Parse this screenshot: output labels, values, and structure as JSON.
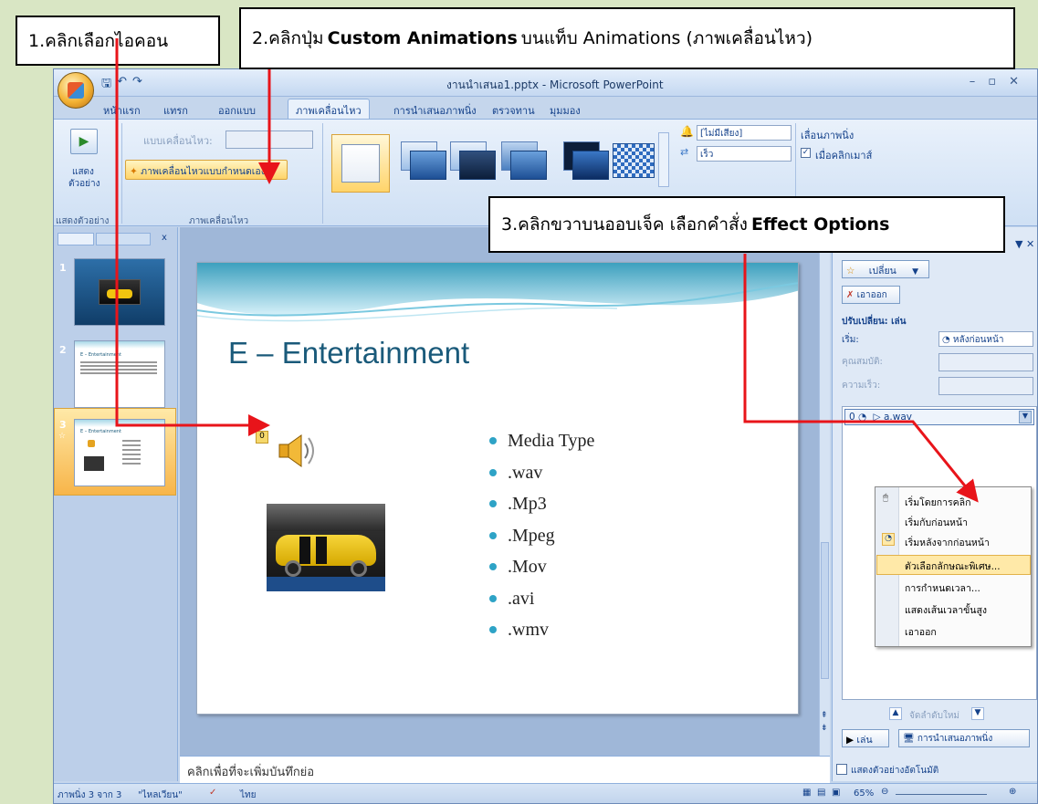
{
  "callouts": {
    "step1": "1.คลิกเลือกไอคอน",
    "step2_prefix": "2.คลิกปุ่ม",
    "step2_bold": "Custom Animations",
    "step2_suffix": "บนแท็บ Animations (ภาพเคลื่อนไหว)",
    "step3_prefix": "3.คลิกขวาบนออบเจ็ค เลือกคำสั่ง",
    "step3_bold": "Effect Options"
  },
  "window": {
    "title": "งานนำเสนอ1.pptx - Microsoft PowerPoint",
    "qat_save": "🖫",
    "qat_undo": "↶",
    "qat_redo": "↷"
  },
  "tabs": [
    {
      "label": "หน้าแรก"
    },
    {
      "label": "แทรก"
    },
    {
      "label": "ออกแบบ"
    },
    {
      "label": "ภาพเคลื่อนไหว"
    },
    {
      "label": "การนำเสนอภาพนิ่ง"
    },
    {
      "label": "ตรวจทาน"
    },
    {
      "label": "มุมมอง"
    }
  ],
  "ribbon": {
    "preview_label_1": "แสดง",
    "preview_label_2": "ตัวอย่าง",
    "preview_group": "แสดงตัวอย่าง",
    "animate_label": "แบบเคลื่อนไหว:",
    "custom_anim_button": "ภาพเคลื่อนไหวแบบกำหนดเอง",
    "anim_group": "ภาพเคลื่อนไหว",
    "sound_value": "[ไม่มีเสียง]",
    "speed_value": "เร็ว",
    "advance_title": "เลื่อนภาพนิ่ง",
    "on_click_label": "เมื่อคลิกเมาส์"
  },
  "slides_pane": {
    "slide_numbers": [
      "1",
      "2",
      "3"
    ],
    "slide2_title": "E – Entertainment",
    "slide3_title": "E – Entertainment"
  },
  "slide": {
    "title": "E – Entertainment",
    "anim_tag": "0",
    "bullets": [
      "Media Type",
      ".wav",
      ".Mp3",
      ".Mpeg",
      ".Mov",
      ".avi",
      ".wmv"
    ]
  },
  "notes": {
    "placeholder": "คลิกเพื่อที่จะเพิ่มบันทึกย่อ"
  },
  "taskpane": {
    "change_button": "เปลี่ยน",
    "remove_button": "เอาออก",
    "modify_heading": "ปรับเปลี่ยน: เล่น",
    "start_label": "เริ่ม:",
    "start_value": "หลังก่อนหน้า",
    "property_label": "คุณสมบัติ:",
    "speed_label": "ความเร็ว:",
    "list_item_num": "0",
    "list_item_name": "a.wav",
    "reorder_label": "จัดลำดับใหม่",
    "play_button": "เล่น",
    "slideshow_button": "การนำเสนอภาพนิ่ง",
    "autopreview_label": "แสดงตัวอย่างอัตโนมัติ"
  },
  "context_menu": [
    "เริ่มโดยการคลิก",
    "เริ่มกับก่อนหน้า",
    "เริ่มหลังจากก่อนหน้า",
    "ตัวเลือกลักษณะพิเศษ...",
    "การกำหนดเวลา...",
    "แสดงเส้นเวลาขั้นสูง",
    "เอาออก"
  ],
  "statusbar": {
    "slide_info": "ภาพนิ่ง 3 จาก 3",
    "theme": "\"ไหลเวียน\"",
    "language": "ไทย",
    "zoom": "65%"
  },
  "colors": {
    "arrow": "#e8141a",
    "accent": "#f3b233"
  }
}
